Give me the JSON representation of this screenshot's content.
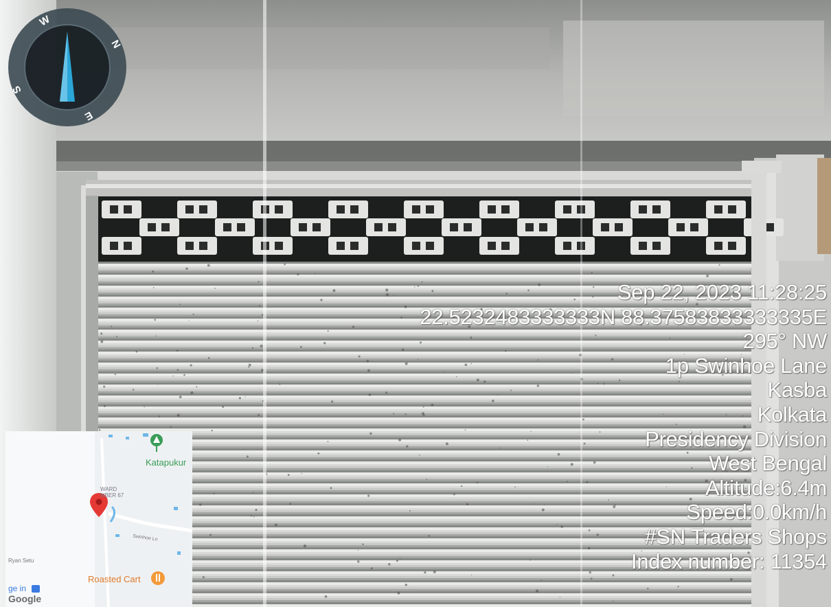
{
  "compass": {
    "letters": {
      "w": "W",
      "n": "N",
      "s": "S",
      "e": "E"
    },
    "needle_color": "#2aa6d8",
    "ring_color": "#3c4a52"
  },
  "overlay": {
    "lines": [
      "Sep 22, 2023 11:28:25",
      "22.5232483333333N 88.37583833333335E",
      "295° NW",
      "1p Swinhoe Lane",
      "Kasba",
      "Kolkata",
      "Presidency Division",
      "West Bengal",
      "Altitude:6.4m",
      "Speed:0.0km/h",
      "#SN Traders Shops",
      "Index number: 11354"
    ]
  },
  "map": {
    "places": {
      "katapukur": "Katapukur",
      "roasted_cart": "Roasted Cart",
      "ward_1": "WARD",
      "ward_2": "MBER 67",
      "road": "Swinhoe Ln",
      "setu": "Ryan Setu",
      "google": "Google",
      "ge_in": "ge in"
    },
    "pin_color": "#e53935",
    "park_color": "#3a9d58",
    "food_color": "#f29a3a"
  }
}
